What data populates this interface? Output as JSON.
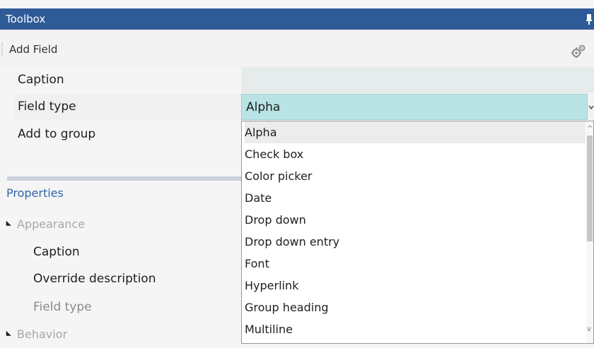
{
  "window": {
    "title": "Toolbox",
    "pin_glyph": "⅌"
  },
  "toolbar": {
    "add_field_label": "Add Field",
    "gear_icon": "gears-icon"
  },
  "form": {
    "caption_label": "Caption",
    "field_type_label": "Field type",
    "add_to_group_label": "Add to group",
    "caption_value": "",
    "field_type_value": "Alpha"
  },
  "properties": {
    "header": "Properties",
    "groups": [
      {
        "label": "Appearance",
        "items": [
          "Caption",
          "Override description",
          "Field type"
        ]
      },
      {
        "label": "Behavior",
        "items": []
      }
    ]
  },
  "dropdown": {
    "options": [
      "Alpha",
      "Check box",
      "Color picker",
      "Date",
      "Drop down",
      "Drop down entry",
      "Font",
      "Hyperlink",
      "Group heading",
      "Multiline"
    ],
    "selected_index": 0
  },
  "colors": {
    "titlebar": "#2e5a97",
    "select_bg": "#b9e3e4",
    "properties_header": "#2f65a8",
    "separator": "#c9d0da"
  }
}
